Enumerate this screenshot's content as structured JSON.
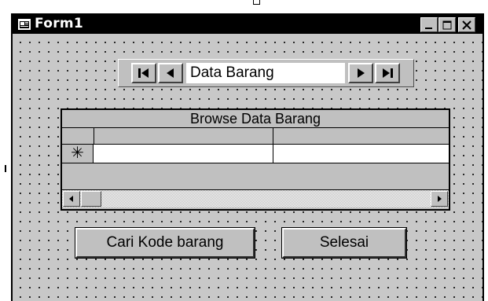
{
  "window": {
    "title": "Form1",
    "icon": "form-icon",
    "caption_buttons": [
      "minimize-icon",
      "maximize-icon",
      "close-icon"
    ]
  },
  "data_control": {
    "caption": "Data Barang",
    "buttons": [
      "first-record-icon",
      "previous-record-icon",
      "next-record-icon",
      "last-record-icon"
    ]
  },
  "grid": {
    "caption": "Browse Data Barang",
    "new_row_marker": "✳"
  },
  "buttons": {
    "search_label": "Cari Kode barang",
    "done_label": "Selesai"
  }
}
